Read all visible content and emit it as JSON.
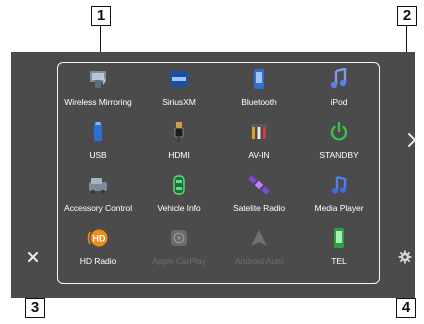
{
  "callouts": [
    "1",
    "2",
    "3",
    "4"
  ],
  "sources": [
    {
      "label": "Wireless Mirroring",
      "icon": "wireless-mirroring-icon"
    },
    {
      "label": "SiriusXM",
      "icon": "siriusxm-icon"
    },
    {
      "label": "Bluetooth",
      "icon": "bluetooth-audio-icon"
    },
    {
      "label": "iPod",
      "icon": "ipod-icon"
    },
    {
      "label": "USB",
      "icon": "usb-icon"
    },
    {
      "label": "HDMI",
      "icon": "hdmi-icon"
    },
    {
      "label": "AV-IN",
      "icon": "av-in-icon"
    },
    {
      "label": "STANDBY",
      "icon": "power-icon"
    },
    {
      "label": "Accessory Control",
      "icon": "accessory-control-icon"
    },
    {
      "label": "Vehicle Info",
      "icon": "vehicle-info-icon"
    },
    {
      "label": "Satelite Radio",
      "icon": "satellite-icon"
    },
    {
      "label": "Media Player",
      "icon": "media-player-icon"
    },
    {
      "label": "HD Radio",
      "icon": "hd-radio-icon"
    },
    {
      "label": "Apple CarPlay",
      "icon": "apple-carplay-icon",
      "disabled": true
    },
    {
      "label": "Android Auto",
      "icon": "android-auto-icon",
      "disabled": true
    },
    {
      "label": "TEL",
      "icon": "phone-icon"
    }
  ],
  "controls": {
    "next": "chevron-right-icon",
    "close": "close-icon",
    "settings": "gear-icon"
  },
  "colors": {
    "screen": "#4b4b4b",
    "accent_blue": "#2f7de1",
    "accent_green": "#39c24a",
    "accent_orange": "#f08a1a"
  }
}
